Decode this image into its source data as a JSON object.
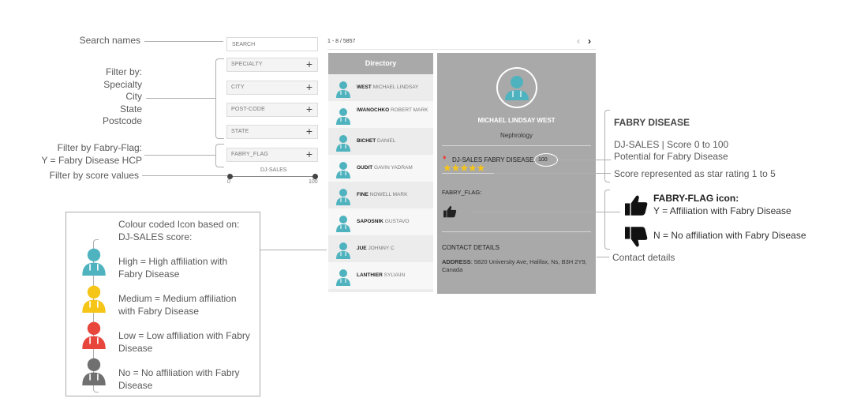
{
  "annotations": {
    "search_names": "Search names",
    "filter_by": [
      "Filter by:",
      "Specialty",
      "City",
      "State",
      "Postcode"
    ],
    "fabry_flag": [
      "Filter by Fabry-Flag:",
      "Y = Fabry Disease HCP"
    ],
    "score_values": "Filter by score values",
    "legend_intro": [
      "Colour coded Icon based on:",
      "DJ-SALES score:"
    ],
    "legend_high": [
      "High = High affiliation with",
      "Fabry Disease"
    ],
    "legend_medium": [
      "Medium = Medium affiliation",
      "with Fabry Disease"
    ],
    "legend_low": [
      "Low = Low affiliation with Fabry",
      "Disease"
    ],
    "legend_no": [
      "No = No affiliation with Fabry",
      "Disease"
    ],
    "fabry_disease_title": "FABRY DISEASE",
    "dj_sales_line": "DJ-SALES | Score 0 to 100",
    "potential_line": "Potential for Fabry Disease",
    "star_line": "Score represented as star rating 1 to 5",
    "flag_icon_title": "FABRY-FLAG icon:",
    "flag_yes": "Y = Affiliation with Fabry Disease",
    "flag_no": "N = No affiliation with Fabry Disease",
    "contact_details": "Contact details"
  },
  "filters": {
    "search_placeholder": "SEARCH",
    "items": [
      "SPECIALTY",
      "CITY",
      "POST-CODE",
      "STATE",
      "FABRY_FLAG"
    ],
    "slider_label": "DJ-SALES",
    "slider_min": "0",
    "slider_max": "100"
  },
  "pager": {
    "range": "1 - 8 / 5857",
    "prev": "‹",
    "next": "›"
  },
  "directory": {
    "title": "Directory",
    "rows": [
      {
        "last": "WEST",
        "first": "MICHAEL LINDSAY"
      },
      {
        "last": "IWANOCHKO",
        "first": "ROBERT MARK"
      },
      {
        "last": "BICHET",
        "first": "DANIEL"
      },
      {
        "last": "OUDIT",
        "first": "GAVIN YADRAM"
      },
      {
        "last": "FINE",
        "first": "NOWELL MARK"
      },
      {
        "last": "SAPOSNIK",
        "first": "GUSTAVO"
      },
      {
        "last": "JUE",
        "first": "JOHNNY C"
      },
      {
        "last": "LANTHIER",
        "first": "SYLVAIN"
      }
    ]
  },
  "detail": {
    "name": "MICHAEL LINDSAY WEST",
    "specialty": "Nephrology",
    "score_label": "DJ-SALES FABRY DISEASE:",
    "score_value": "100",
    "star_rating": 5,
    "fabry_flag_label": "FABRY_FLAG:",
    "contact_header": "CONTACT DETAILS",
    "address_label": "ADDRESS",
    "address_value": ": 5820 University Ave, Halifax, Ns, B3H 2Y9, Canada"
  },
  "colors": {
    "high": "#4fb3bf",
    "medium": "#f5c518",
    "low": "#e8453c",
    "no": "#707070",
    "panel": "#a9a9a9",
    "star": "#f5c518"
  },
  "icons": [
    "person-high-icon",
    "person-medium-icon",
    "person-low-icon",
    "person-none-icon",
    "thumbs-up-icon",
    "thumbs-down-icon",
    "flame-icon",
    "star-icon"
  ]
}
